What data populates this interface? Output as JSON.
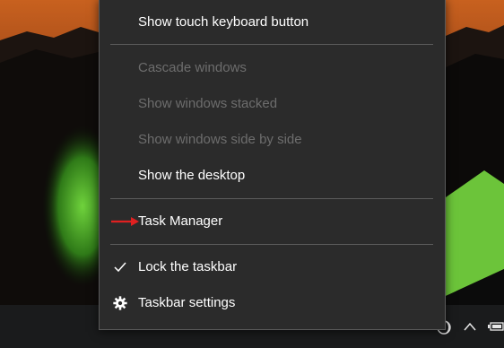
{
  "context_menu": {
    "items": [
      {
        "label": "Show touch keyboard button",
        "enabled": true,
        "checked": false,
        "icon": ""
      },
      {
        "label": "Cascade windows",
        "enabled": false,
        "checked": false,
        "icon": ""
      },
      {
        "label": "Show windows stacked",
        "enabled": false,
        "checked": false,
        "icon": ""
      },
      {
        "label": "Show windows side by side",
        "enabled": false,
        "checked": false,
        "icon": ""
      },
      {
        "label": "Show the desktop",
        "enabled": true,
        "checked": false,
        "icon": ""
      },
      {
        "label": "Task Manager",
        "enabled": true,
        "checked": false,
        "icon": "",
        "annotated": true
      },
      {
        "label": "Lock the taskbar",
        "enabled": true,
        "checked": true,
        "icon": "checkmark-icon"
      },
      {
        "label": "Taskbar settings",
        "enabled": true,
        "checked": false,
        "icon": "gear-icon"
      }
    ]
  },
  "annotation": {
    "icon": "red-arrow-icon",
    "color": "#e02020"
  },
  "taskbar": {
    "tray_icons": [
      "moon-icon",
      "chevron-up-icon",
      "battery-icon"
    ]
  },
  "colors": {
    "menu_background": "#2b2b2b",
    "menu_text": "#ffffff",
    "menu_disabled_text": "#6d6d6d",
    "separator": "#5c5c5c",
    "taskbar": "#1a1b1c"
  }
}
